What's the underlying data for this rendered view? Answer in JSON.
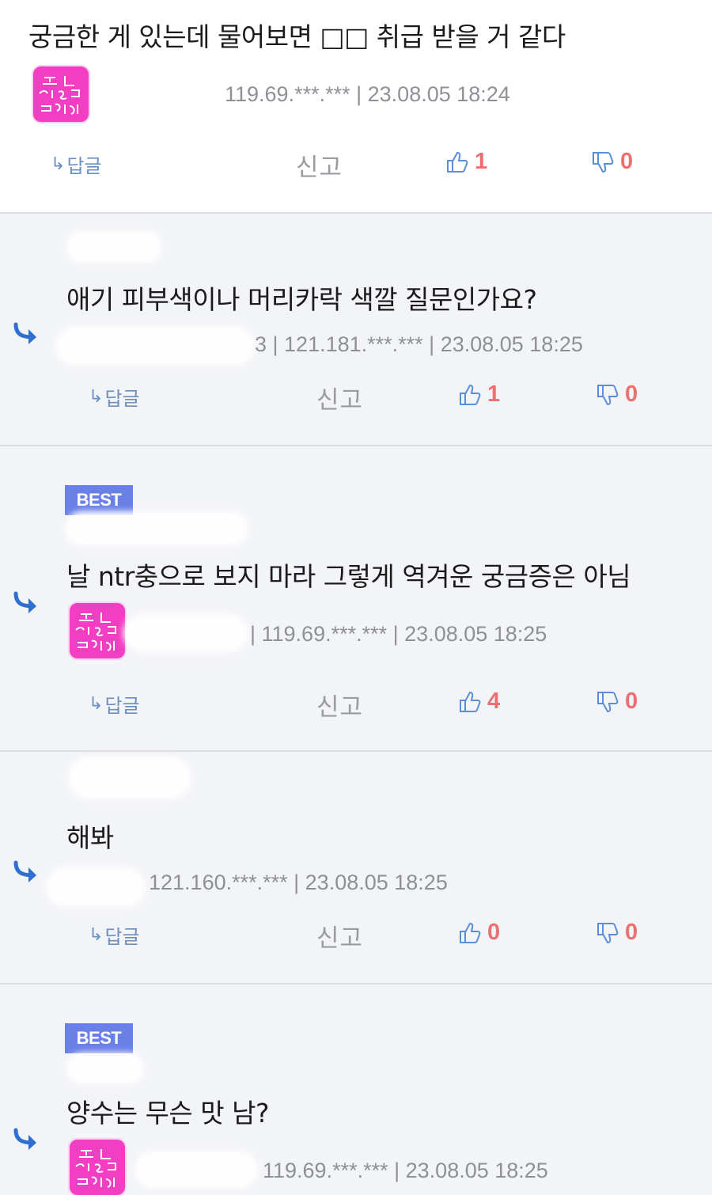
{
  "post": {
    "text": "궁금한 게 있는데 물어보면 □□ 취급 받을 거 같다",
    "meta": "119.69.***.*** | 23.08.05 18:24",
    "reply_label": "답글",
    "report_label": "신고",
    "likes": "1",
    "dislikes": "0"
  },
  "replies": [
    {
      "text": "애기 피부색이나 머리카락 색깔 질문인가요?",
      "meta": "3 | 121.181.***.*** | 23.08.05 18:25",
      "reply_label": "답글",
      "report_label": "신고",
      "likes": "1",
      "dislikes": "0"
    },
    {
      "badge": "BEST",
      "text": "날 ntr충으로 보지 마라 그렇게 역겨운 궁금증은 아님",
      "meta": "| 119.69.***.*** | 23.08.05 18:25",
      "reply_label": "답글",
      "report_label": "신고",
      "likes": "4",
      "dislikes": "0"
    },
    {
      "text": "해봐",
      "meta": "121.160.***.*** | 23.08.05 18:25",
      "reply_label": "답글",
      "report_label": "신고",
      "likes": "0",
      "dislikes": "0"
    },
    {
      "badge": "BEST",
      "text": "양수는 무슨 맛 남?",
      "meta": "119.69.***.*** | 23.08.05 18:25"
    }
  ],
  "icons": {
    "reply_arrow": "reply-arrow-icon",
    "like": "thumbs-up-icon",
    "dislike": "thumbs-down-icon",
    "avatar": "avatar-image"
  },
  "colors": {
    "reply_bg": "#f3f4f7",
    "vote_count": "#ee6f6f",
    "reply_link": "#6a8fc0",
    "best_badge": "#6a80e6",
    "avatar_pink": "#f23ec2",
    "reply_arrow": "#2f6fd0"
  }
}
